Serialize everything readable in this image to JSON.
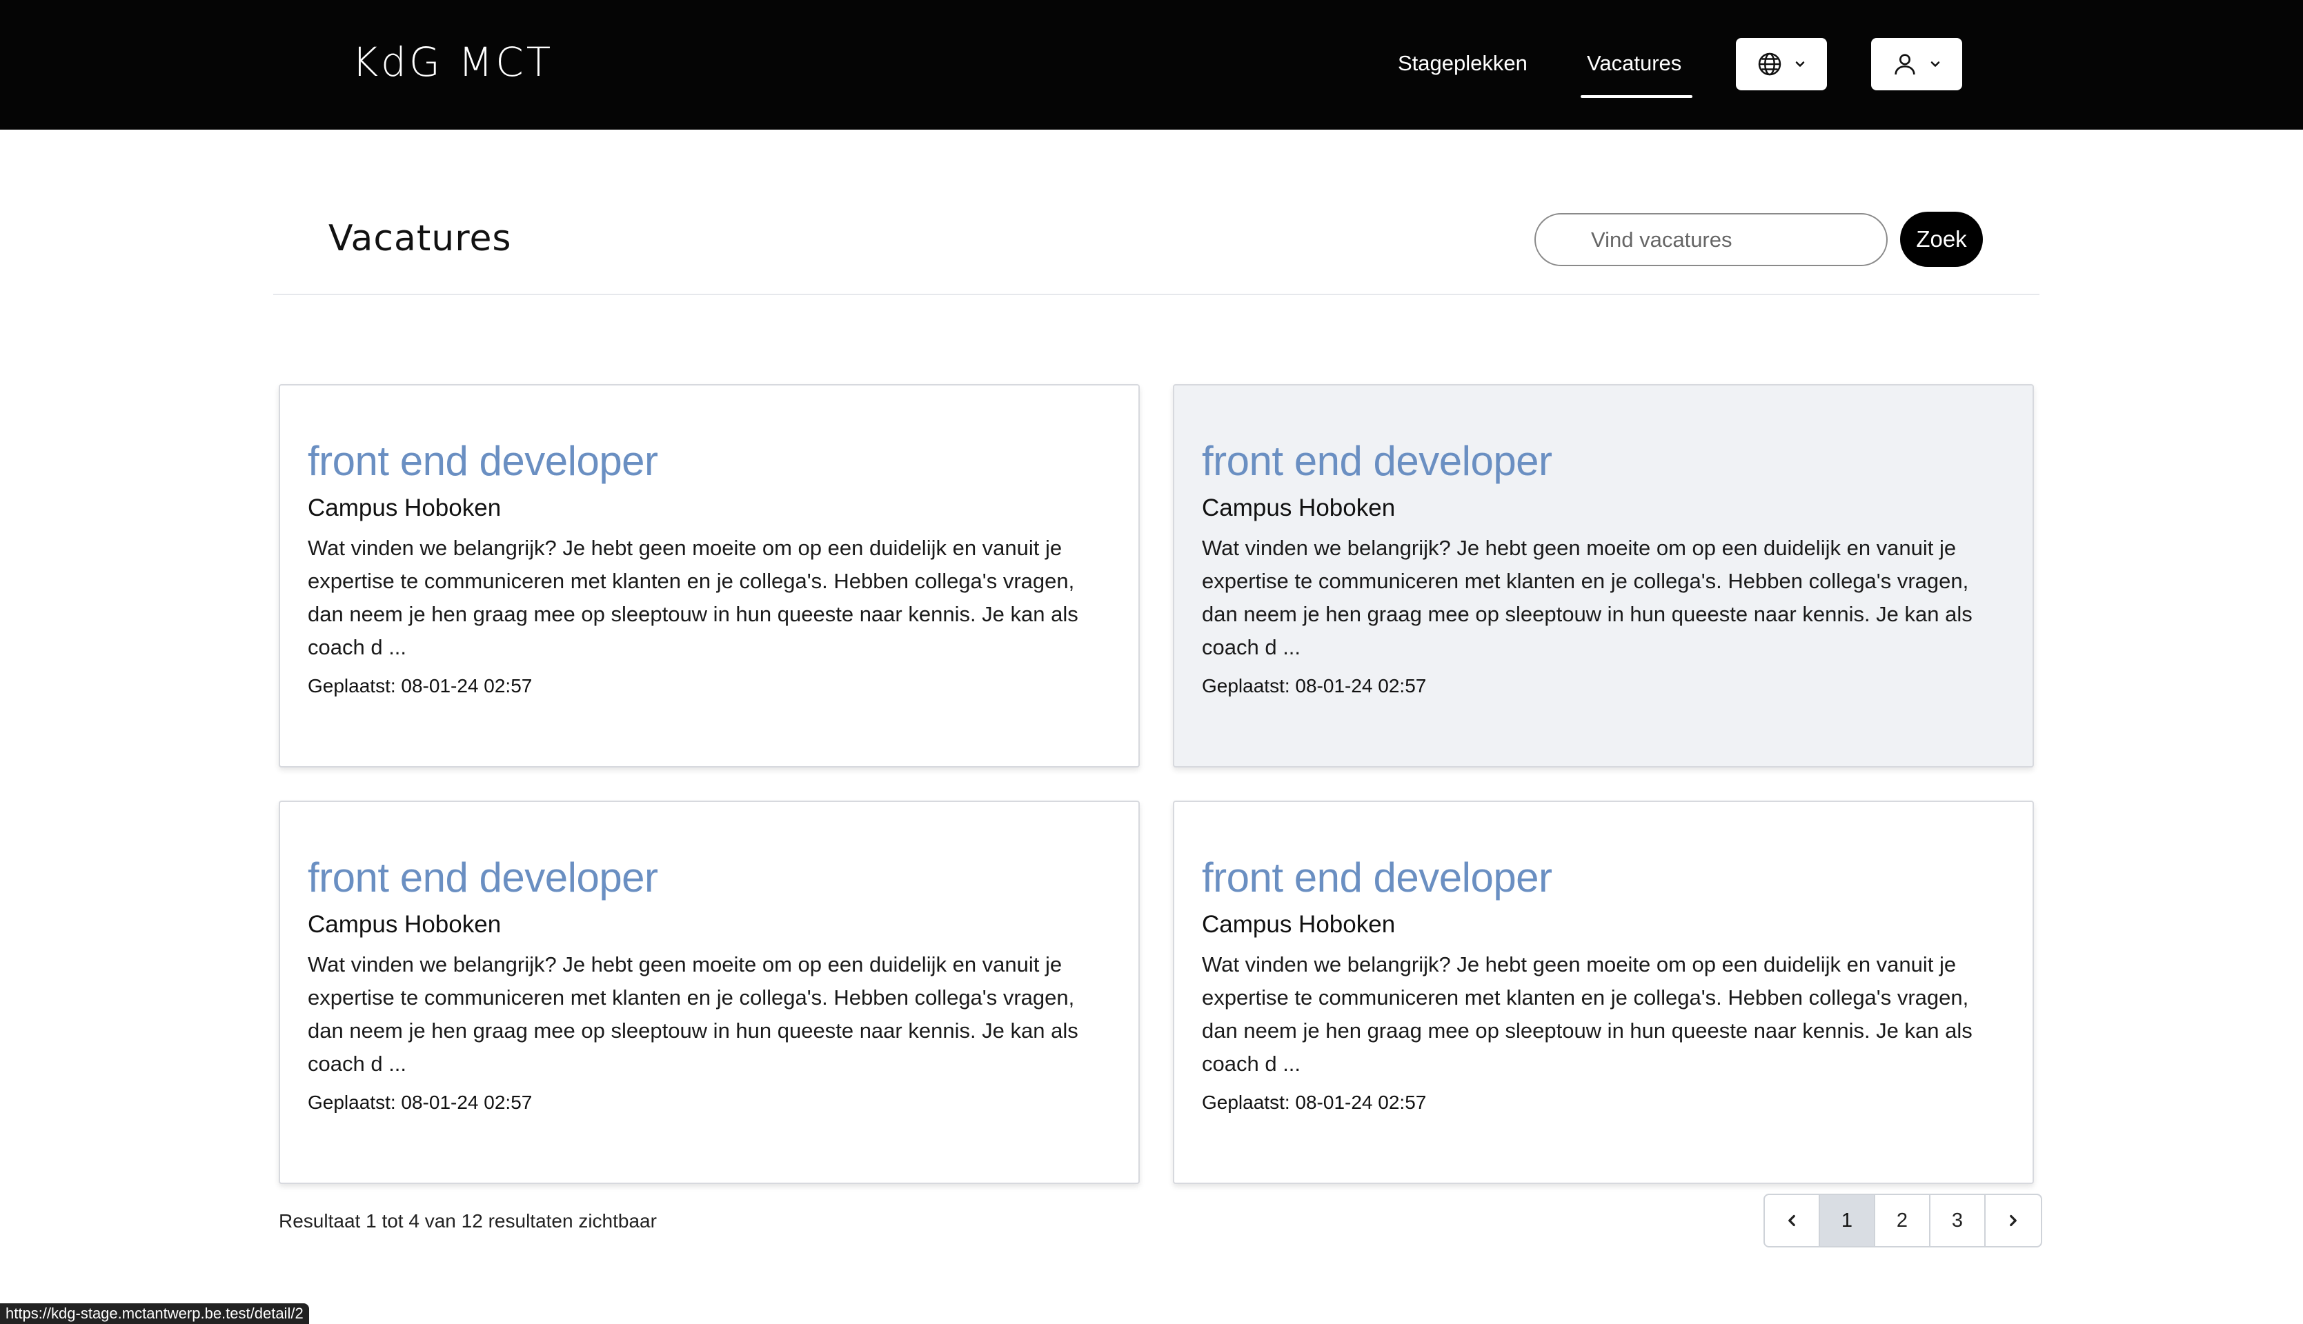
{
  "header": {
    "logo": "KdG MCT",
    "nav": [
      {
        "label": "Stageplekken",
        "active": false
      },
      {
        "label": "Vacatures",
        "active": true
      }
    ],
    "language_icon": "globe-icon",
    "user_icon": "user-icon"
  },
  "page": {
    "title": "Vacatures",
    "search": {
      "placeholder": "Vind vacatures",
      "value": "",
      "button_label": "Zoek"
    }
  },
  "cards": [
    {
      "title": "front end developer",
      "company": "Campus Hoboken",
      "description": "Wat vinden we belangrijk? Je hebt geen moeite om op een duidelijk en vanuit je expertise te communiceren met klanten en je collega's. Hebben collega's vragen, dan neem je hen graag mee op sleeptouw in hun queeste naar kennis. Je kan als coach d ...",
      "date": "Geplaatst: 08-01-24 02:57"
    },
    {
      "title": "front end developer",
      "company": "Campus Hoboken",
      "description": "Wat vinden we belangrijk? Je hebt geen moeite om op een duidelijk en vanuit je expertise te communiceren met klanten en je collega's. Hebben collega's vragen, dan neem je hen graag mee op sleeptouw in hun queeste naar kennis. Je kan als coach d ...",
      "date": "Geplaatst: 08-01-24 02:57"
    },
    {
      "title": "front end developer",
      "company": "Campus Hoboken",
      "description": "Wat vinden we belangrijk? Je hebt geen moeite om op een duidelijk en vanuit je expertise te communiceren met klanten en je collega's. Hebben collega's vragen, dan neem je hen graag mee op sleeptouw in hun queeste naar kennis. Je kan als coach d ...",
      "date": "Geplaatst: 08-01-24 02:57"
    },
    {
      "title": "front end developer",
      "company": "Campus Hoboken",
      "description": "Wat vinden we belangrijk? Je hebt geen moeite om op een duidelijk en vanuit je expertise te communiceren met klanten en je collega's. Hebben collega's vragen, dan neem je hen graag mee op sleeptouw in hun queeste naar kennis. Je kan als coach d ...",
      "date": "Geplaatst: 08-01-24 02:57"
    }
  ],
  "results": {
    "prefix": "Resultaat",
    "from": "1",
    "to_word": "tot",
    "to": "4",
    "of_word": "van",
    "total": "12",
    "suffix": "resultaten zichtbaar"
  },
  "pagination": {
    "prev_icon": "chevron-left-icon",
    "pages": [
      "1",
      "2",
      "3"
    ],
    "current": "1",
    "next_icon": "chevron-right-icon"
  },
  "status_bar": {
    "url": "https://kdg-stage.mctantwerp.be.test/detail/2"
  },
  "colors": {
    "header_bg": "#050505",
    "card_title": "#6a8fc2",
    "hovered_card_bg": "#f0f2f5",
    "active_page_bg": "#d9dde3"
  }
}
